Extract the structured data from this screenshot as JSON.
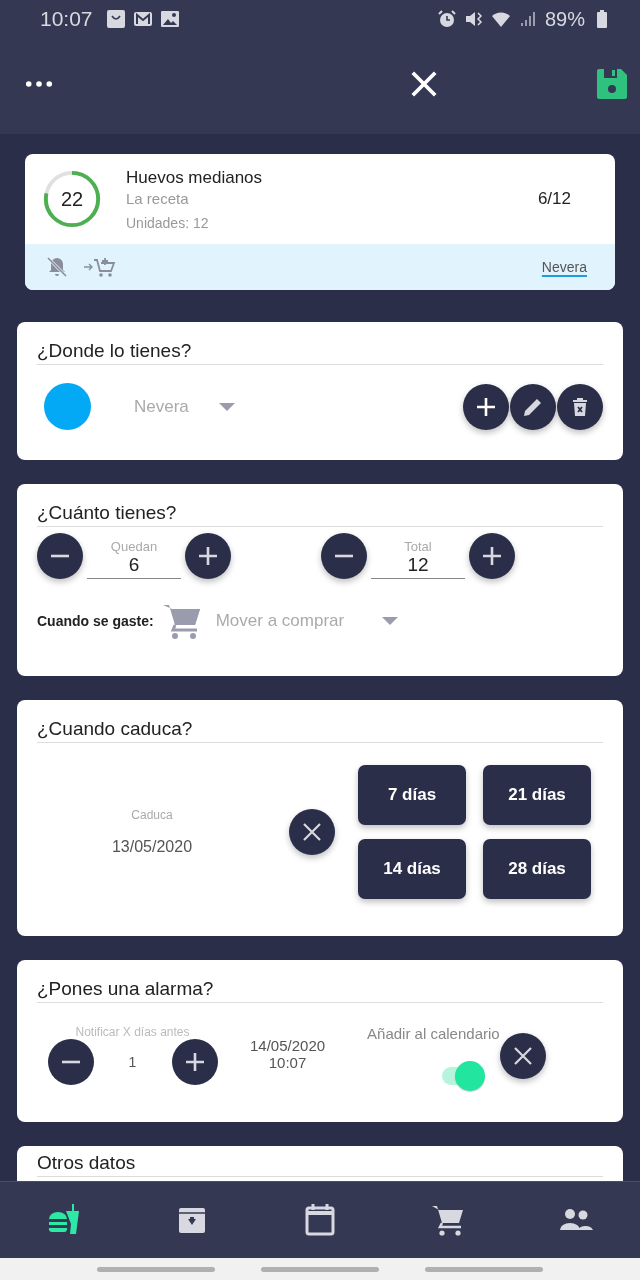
{
  "status_bar": {
    "time": "10:07",
    "battery": "89%"
  },
  "product": {
    "count": "22",
    "level": 0.78,
    "name": "Huevos medianos",
    "subtitle": "La receta",
    "units": "Unidades: 12",
    "ratio": "6/12",
    "location_link": "Nevera"
  },
  "location": {
    "title": "¿Donde lo tienes?",
    "color": "#03a9f4",
    "value": "Nevera"
  },
  "quantity": {
    "title": "¿Cuánto tienes?",
    "steppers": [
      {
        "label": "Quedan",
        "value": "6"
      },
      {
        "label": "Total",
        "value": "12"
      }
    ],
    "on_spent_label": "Cuando se gaste:",
    "on_spent_value": "Mover a comprar"
  },
  "expiry": {
    "title": "¿Cuando caduca?",
    "label": "Caduca",
    "date": "13/05/2020",
    "presets": [
      "7 días",
      "21 días",
      "14 días",
      "28 días"
    ]
  },
  "alarm": {
    "title": "¿Pones una alarma?",
    "label": "Notificar X días antes",
    "value": "1",
    "date": "14/05/2020",
    "time": "10:07",
    "calendar_label": "Añadir al calendario",
    "calendar_on": true
  },
  "other": {
    "title": "Otros datos"
  },
  "nav": [
    {
      "kind": "food",
      "selected": true
    },
    {
      "kind": "archive",
      "selected": false
    },
    {
      "kind": "calendar",
      "selected": false
    },
    {
      "kind": "cart",
      "selected": false
    },
    {
      "kind": "people",
      "selected": false
    }
  ]
}
